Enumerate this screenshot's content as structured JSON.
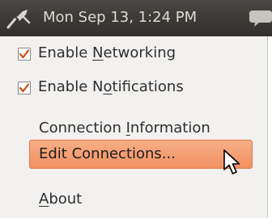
{
  "panel": {
    "network_icon": "network-disconnected-icon",
    "clock": "Mon Sep 13,  1:24 PM",
    "chat_icon": "chat-bubble-icon"
  },
  "menu": {
    "enable_networking": {
      "checked": true,
      "pre": "Enable ",
      "mnemonic": "N",
      "post": "etworking"
    },
    "enable_notifications": {
      "checked": true,
      "pre": "Enable N",
      "mnemonic": "o",
      "post": "tifications"
    },
    "connection_information": {
      "pre": "Connection ",
      "mnemonic": "I",
      "post": "nformation"
    },
    "edit_connections": {
      "label": "Edit Connections...",
      "highlighted": true
    },
    "about": {
      "pre": "",
      "mnemonic": "A",
      "post": "bout"
    }
  },
  "colors": {
    "panel_bg": "#3c3b37",
    "menu_bg": "#f2f1f0",
    "highlight": "#f4a27a",
    "checkmark": "#d14a0e"
  },
  "cursor_icon": "mouse-pointer-icon"
}
